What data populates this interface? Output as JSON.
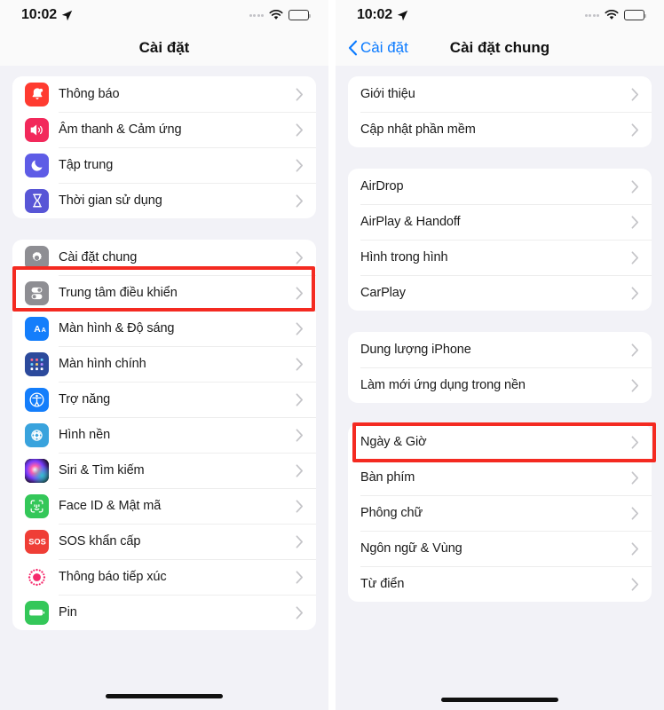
{
  "left": {
    "status": {
      "time": "10:02",
      "location_icon": "location-arrow-icon",
      "wifi_icon": "wifi-icon",
      "battery_icon": "battery-full-icon"
    },
    "nav": {
      "title": "Cài đặt"
    },
    "groups": [
      {
        "id": "group-1",
        "items": [
          {
            "label": "Thông báo",
            "icon": "notifications-bell-icon",
            "color": "#ff3b30"
          },
          {
            "label": "Âm thanh & Cảm ứng",
            "icon": "sound-speaker-icon",
            "color": "#f2295b"
          },
          {
            "label": "Tập trung",
            "icon": "focus-moon-icon",
            "color": "#5e5ce6"
          },
          {
            "label": "Thời gian sử dụng",
            "icon": "screen-time-hourglass-icon",
            "color": "#5856d6"
          }
        ]
      },
      {
        "id": "group-2",
        "items": [
          {
            "label": "Cài đặt chung",
            "icon": "general-gear-icon",
            "color": "#8e8e93",
            "highlighted": true
          },
          {
            "label": "Trung tâm điều khiển",
            "icon": "control-center-toggles-icon",
            "color": "#8e8e93"
          },
          {
            "label": "Màn hình & Độ sáng",
            "icon": "display-brightness-aa-icon",
            "color": "#147efb"
          },
          {
            "label": "Màn hình chính",
            "icon": "home-screen-grid-icon",
            "color": "#2c4a9c"
          },
          {
            "label": "Trợ năng",
            "icon": "accessibility-icon",
            "color": "#147efb"
          },
          {
            "label": "Hình nền",
            "icon": "wallpaper-flower-icon",
            "color": "#39a3dd"
          },
          {
            "label": "Siri & Tìm kiếm",
            "icon": "siri-orb-icon",
            "color": "#2a1a33"
          },
          {
            "label": "Face ID & Mật mã",
            "icon": "face-id-icon",
            "color": "#34c759"
          },
          {
            "label": "SOS khẩn cấp",
            "icon": "emergency-sos-icon",
            "color": "#ef3e36"
          },
          {
            "label": "Thông báo tiếp xúc",
            "icon": "exposure-notification-icon",
            "color": "#ffffff"
          },
          {
            "label": "Pin",
            "icon": "battery-green-icon",
            "color": "#34c759"
          }
        ]
      }
    ]
  },
  "right": {
    "status": {
      "time": "10:02",
      "location_icon": "location-arrow-icon",
      "wifi_icon": "wifi-icon",
      "battery_icon": "battery-full-icon"
    },
    "nav": {
      "back_label": "Cài đặt",
      "back_icon": "chevron-left-icon",
      "title": "Cài đặt chung"
    },
    "groups": [
      {
        "id": "group-1",
        "items": [
          {
            "label": "Giới thiệu"
          },
          {
            "label": "Cập nhật phần mềm"
          }
        ]
      },
      {
        "id": "group-2",
        "items": [
          {
            "label": "AirDrop"
          },
          {
            "label": "AirPlay & Handoff"
          },
          {
            "label": "Hình trong hình"
          },
          {
            "label": "CarPlay"
          }
        ]
      },
      {
        "id": "group-3",
        "items": [
          {
            "label": "Dung lượng iPhone"
          },
          {
            "label": "Làm mới ứng dụng trong nền",
            "highlighted": true
          }
        ]
      },
      {
        "id": "group-4",
        "items": [
          {
            "label": "Ngày & Giờ"
          },
          {
            "label": "Bàn phím"
          },
          {
            "label": "Phông chữ"
          },
          {
            "label": "Ngôn ngữ & Vùng"
          },
          {
            "label": "Từ điển"
          }
        ]
      }
    ]
  },
  "annotations": {
    "highlight_color": "#f42a21",
    "left_target": "Cài đặt chung",
    "right_target": "Làm mới ứng dụng trong nền"
  }
}
